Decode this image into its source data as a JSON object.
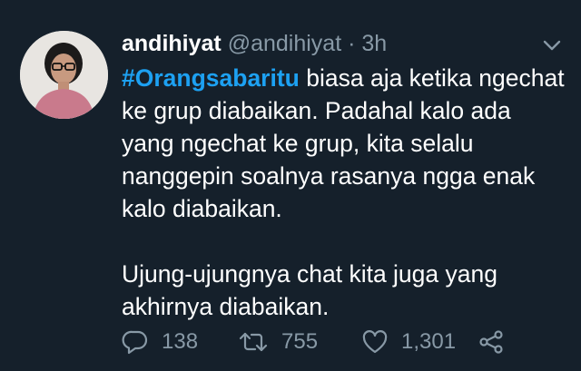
{
  "tweet": {
    "display_name": "andihiyat",
    "handle": "@andihiyat",
    "separator": "·",
    "time": "3h",
    "hashtag": "#Orangsabaritu",
    "text_after_hashtag": " biasa aja ketika ngechat ke grup diabaikan. Padahal kalo ada yang ngechat ke grup, kita selalu nanggepin soalnya rasanya ngga enak kalo diabaikan.",
    "paragraph_2": "Ujung-ujungnya chat kita juga yang akhirnya diabaikan."
  },
  "actions": {
    "reply_count": "138",
    "retweet_count": "755",
    "like_count": "1,301"
  },
  "icons": {
    "reply": "reply-icon",
    "retweet": "retweet-icon",
    "like": "heart-icon",
    "share": "share-icon",
    "menu": "chevron-down-icon"
  },
  "colors": {
    "background": "#15202b",
    "text": "#ffffff",
    "secondary": "#8899a6",
    "hashtag": "#1da1f2"
  }
}
